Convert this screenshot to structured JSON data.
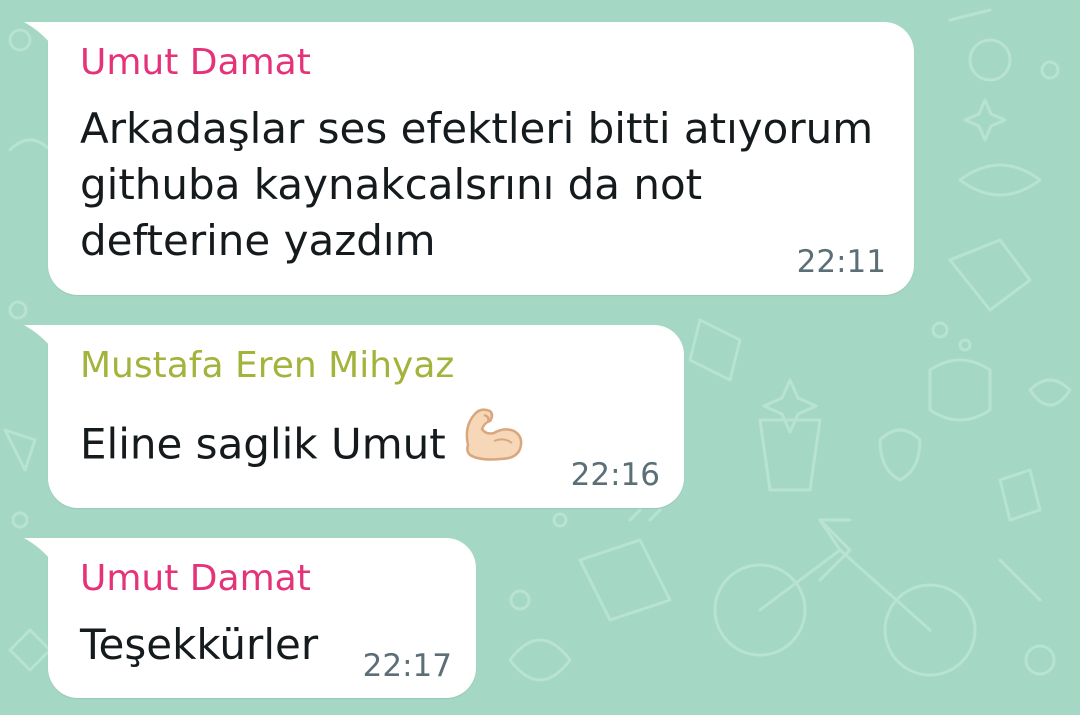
{
  "chat": {
    "messages": [
      {
        "sender": "Umut Damat",
        "sender_color": "#e5337a",
        "text": "Arkadaşlar ses efektleri bitti atıyorum\ngithuba kaynakcalsrını da not\ndefterine yazdım",
        "time": "22:11"
      },
      {
        "sender": "Mustafa Eren Mihyaz",
        "sender_color": "#a4b33c",
        "text": "Eline saglik Umut",
        "emoji": "flexed-biceps-icon",
        "time": "22:16"
      },
      {
        "sender": "Umut Damat",
        "sender_color": "#e5337a",
        "text": "Teşekkürler",
        "time": "22:17"
      }
    ]
  },
  "colors": {
    "background": "#a4d8c4",
    "bubble": "#ffffff",
    "timestamp": "#5c6e76"
  }
}
